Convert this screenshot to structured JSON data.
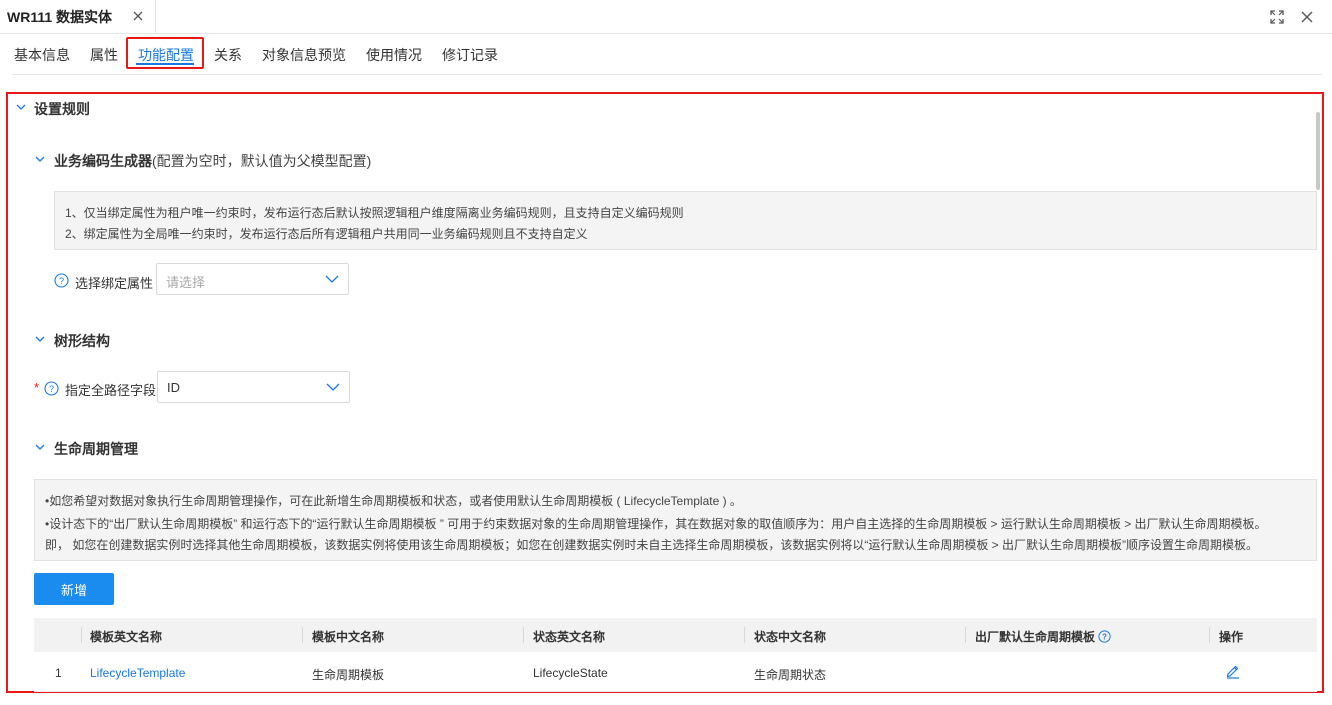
{
  "window": {
    "title": "WR111 数据实体",
    "close_icon": "close-icon",
    "expand_icon": "expand-icon",
    "window_close_icon": "close-icon"
  },
  "tabs": [
    {
      "label": "基本信息"
    },
    {
      "label": "属性"
    },
    {
      "label": "功能配置",
      "active": true
    },
    {
      "label": "关系"
    },
    {
      "label": "对象信息预览"
    },
    {
      "label": "使用情况"
    },
    {
      "label": "修订记录"
    }
  ],
  "settings": {
    "title": "设置规则",
    "code_generator": {
      "title": "业务编码生成器",
      "subtitle": "(配置为空时，默认值为父模型配置)",
      "notes": [
        "1、仅当绑定属性为租户唯一约束时，发布运行态后默认按照逻辑租户维度隔离业务编码规则，且支持自定义编码规则",
        "2、绑定属性为全局唯一约束时，发布运行态后所有逻辑租户共用同一业务编码规则且不支持自定义"
      ],
      "bind_field": {
        "label": "选择绑定属性",
        "placeholder": "请选择"
      }
    },
    "tree": {
      "title": "树形结构",
      "path_field": {
        "required_mark": "*",
        "label": "指定全路径字段",
        "value": "ID"
      }
    },
    "lifecycle": {
      "title": "生命周期管理",
      "notes": [
        "•如您希望对数据对象执行生命周期管理操作，可在此新增生命周期模板和状态，或者使用默认生命周期模板 ( LifecycleTemplate ) 。",
        "•设计态下的“出厂默认生命周期模板” 和运行态下的“运行默认生命周期模板 ” 可用于约束数据对象的生命周期管理操作，其在数据对象的取值顺序为：用户自主选择的生命周期模板 > 运行默认生命周期模板 > 出厂默认生命周期模板。",
        "即， 如您在创建数据实例时选择其他生命周期模板，该数据实例将使用该生命周期模板；如您在创建数据实例时未自主选择生命周期模板，该数据实例将以“运行默认生命周期模板 > 出厂默认生命周期模板”顺序设置生命周期模板。"
      ],
      "add_button": "新增",
      "table": {
        "columns": [
          "模板英文名称",
          "模板中文名称",
          "状态英文名称",
          "状态中文名称",
          "出厂默认生命周期模板",
          "操作"
        ],
        "rows": [
          {
            "index": "1",
            "template_en": "LifecycleTemplate",
            "template_cn": "生命周期模板",
            "state_en": "LifecycleState",
            "state_cn": "生命周期状态",
            "default": ""
          }
        ]
      }
    }
  },
  "colors": {
    "accent": "#1a78e0",
    "highlight": "#e81818",
    "button": "#1a8cf0"
  }
}
